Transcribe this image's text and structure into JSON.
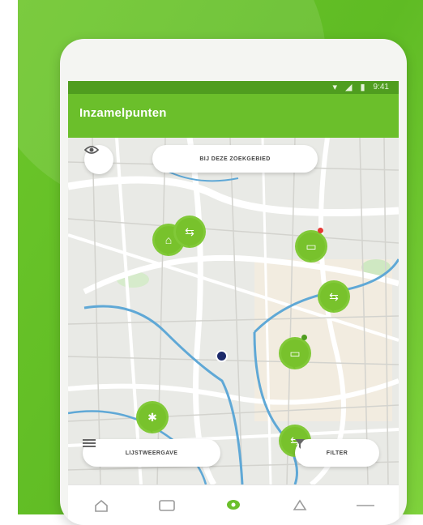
{
  "app": {
    "title": "Inzamelpunten"
  },
  "status_bar": {
    "time": "9:41"
  },
  "map_controls": {
    "top_button_label": "BIJ DEZE ZOEKGEBIED",
    "list_button_label": "LIJSTWEERGAVE",
    "filter_button_label": "FILTER"
  },
  "colors": {
    "brand_green": "#6bbf2b",
    "status_green": "#4f9d1f",
    "pin_green": "#78c22c",
    "alert_red": "#e53935",
    "user_location": "#1d2b6b"
  },
  "icons": {
    "visibility": "eye-icon",
    "list": "list-icon",
    "filter": "filter-icon",
    "nav_home": "home-icon",
    "nav_wallet": "wallet-icon",
    "nav_map": "map-pin-icon",
    "nav_recycle": "recycle-icon",
    "nav_more": "more-icon"
  },
  "pins": [
    {
      "id": "pin-1",
      "icon": "bag-icon"
    },
    {
      "id": "pin-2",
      "icon": "container-icon",
      "badge": "red"
    },
    {
      "id": "pin-3",
      "icon": "truck-icon"
    },
    {
      "id": "pin-4",
      "icon": "container-icon",
      "badge": "green"
    },
    {
      "id": "pin-5",
      "icon": "bulb-icon"
    },
    {
      "id": "pin-6",
      "icon": "truck-icon"
    }
  ]
}
